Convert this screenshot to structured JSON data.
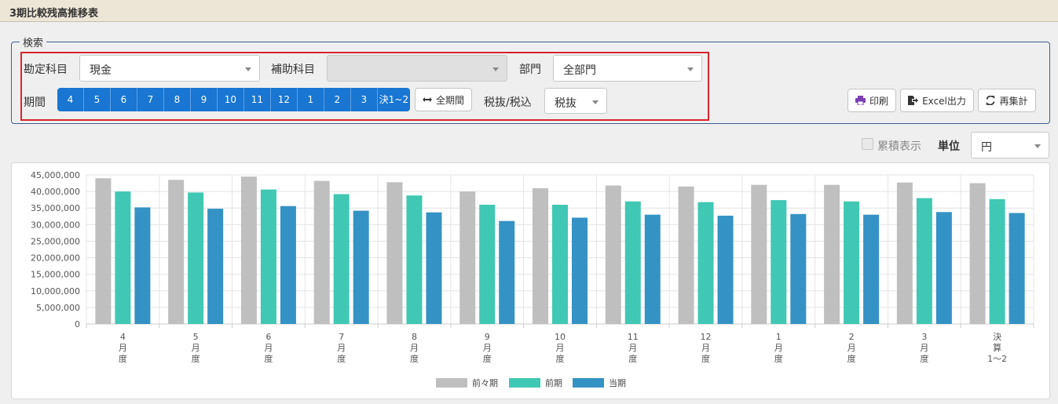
{
  "page": {
    "title": "3期比較残高推移表"
  },
  "search": {
    "legend": "検索",
    "account_label": "勘定科目",
    "account_value": "現金",
    "subaccount_label": "補助科目",
    "subaccount_value": "",
    "dept_label": "部門",
    "dept_value": "全部門",
    "period_label": "期間",
    "periods": [
      "4",
      "5",
      "6",
      "7",
      "8",
      "9",
      "10",
      "11",
      "12",
      "1",
      "2",
      "3",
      "決1~2"
    ],
    "all_period_label": "全期間",
    "tax_label": "税抜/税込",
    "tax_value": "税抜"
  },
  "actions": {
    "print": "印刷",
    "excel": "Excel出力",
    "recalc": "再集計"
  },
  "options": {
    "cumulative_label": "累積表示",
    "unit_label": "単位",
    "unit_value": "円"
  },
  "colors": {
    "prev2": "#bfbfbf",
    "prev": "#40c8b4",
    "curr": "#3592c4",
    "accent": "#1976d2",
    "highlight": "#d6252e"
  },
  "chart_data": {
    "type": "bar",
    "categories": [
      [
        "4",
        "月",
        "度"
      ],
      [
        "5",
        "月",
        "度"
      ],
      [
        "6",
        "月",
        "度"
      ],
      [
        "7",
        "月",
        "度"
      ],
      [
        "8",
        "月",
        "度"
      ],
      [
        "9",
        "月",
        "度"
      ],
      [
        "10",
        "月",
        "度"
      ],
      [
        "11",
        "月",
        "度"
      ],
      [
        "12",
        "月",
        "度"
      ],
      [
        "1",
        "月",
        "度"
      ],
      [
        "2",
        "月",
        "度"
      ],
      [
        "3",
        "月",
        "度"
      ],
      [
        "決",
        "算",
        "1〜2"
      ]
    ],
    "series": [
      {
        "name": "前々期",
        "values": [
          44000000,
          43500000,
          44500000,
          43200000,
          42800000,
          40000000,
          41000000,
          41800000,
          41500000,
          42000000,
          42000000,
          42700000,
          42500000
        ]
      },
      {
        "name": "前期",
        "values": [
          40000000,
          39700000,
          40600000,
          39200000,
          38800000,
          36000000,
          36000000,
          37000000,
          36800000,
          37400000,
          37000000,
          38000000,
          37700000
        ]
      },
      {
        "name": "当期",
        "values": [
          35200000,
          34800000,
          35600000,
          34200000,
          33700000,
          31100000,
          32100000,
          33000000,
          32700000,
          33200000,
          33000000,
          33800000,
          33500000
        ]
      }
    ],
    "ylim": [
      0,
      45000000
    ],
    "yticks": [
      "45,000,000",
      "40,000,000",
      "35,000,000",
      "30,000,000",
      "25,000,000",
      "20,000,000",
      "15,000,000",
      "10,000,000",
      "5,000,000",
      "0"
    ],
    "legend": "bottom-center",
    "grid": true
  }
}
